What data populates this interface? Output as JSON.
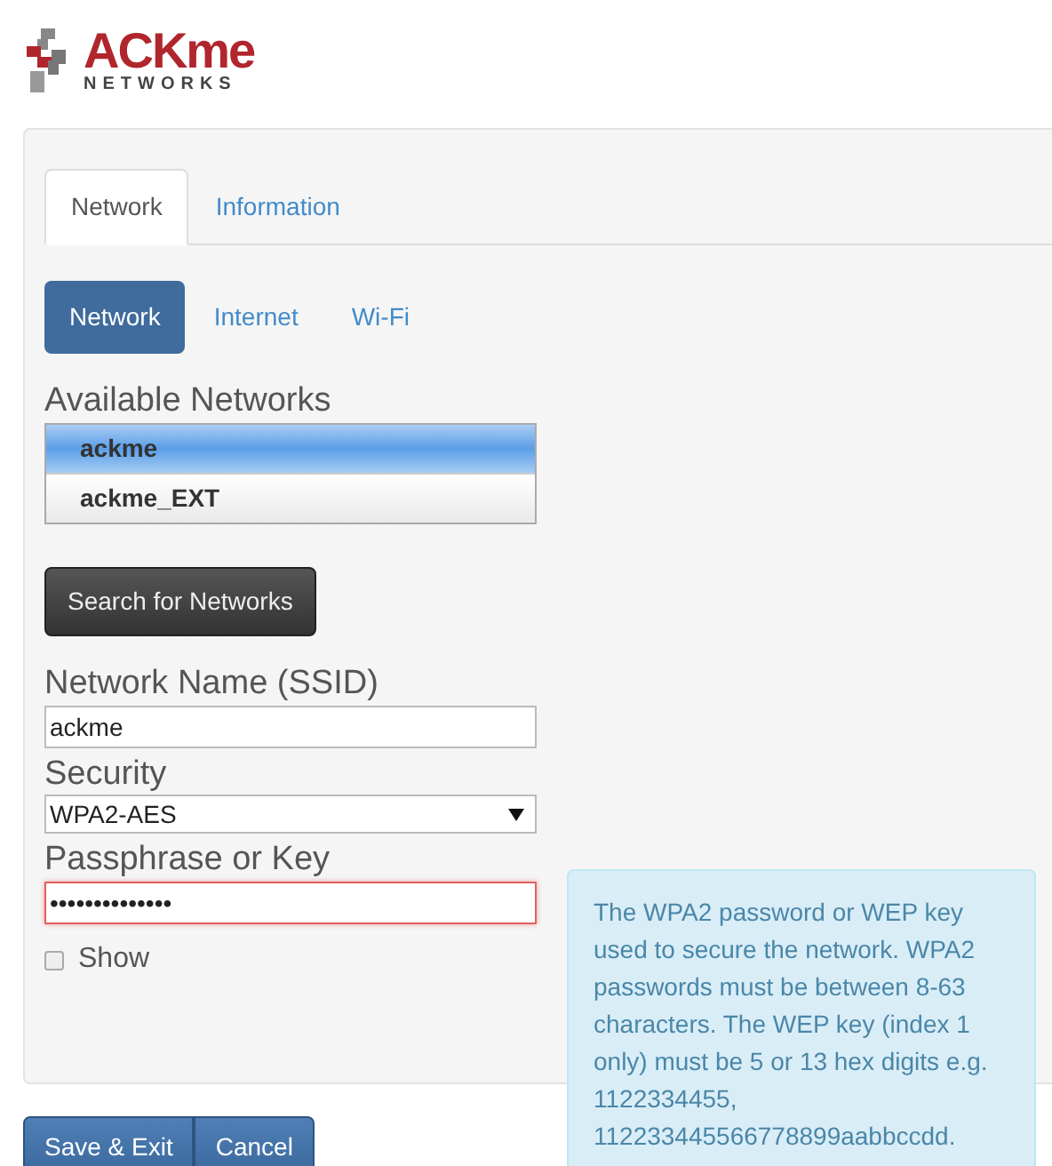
{
  "logo": {
    "name": "ACKme",
    "subtitle": "NETWORKS"
  },
  "tabs": [
    {
      "label": "Network",
      "selected": true
    },
    {
      "label": "Information",
      "selected": false
    }
  ],
  "pills": [
    {
      "label": "Network",
      "selected": true
    },
    {
      "label": "Internet",
      "selected": false
    },
    {
      "label": "Wi-Fi",
      "selected": false
    }
  ],
  "available_networks": {
    "label": "Available Networks",
    "items": [
      {
        "label": "ackme",
        "selected": true
      },
      {
        "label": "ackme_EXT",
        "selected": false
      }
    ]
  },
  "search_button": "Search for Networks",
  "ssid": {
    "label": "Network Name (SSID)",
    "value": "ackme"
  },
  "security": {
    "label": "Security",
    "value": "WPA2-AES"
  },
  "passphrase": {
    "label": "Passphrase or Key",
    "value": "••••••••••••••",
    "invalid": true
  },
  "show": {
    "label": "Show",
    "checked": false
  },
  "help": "The WPA2 password or WEP key used to secure the network. WPA2 passwords must be between 8-63 characters. The WEP key (index 1 only) must be 5 or 13 hex digits e.g. 1122334455, 112233445566778899aabbccdd.",
  "buttons": [
    "Save & Exit",
    "Cancel"
  ]
}
